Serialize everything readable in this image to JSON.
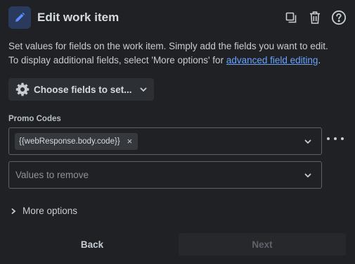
{
  "header": {
    "title": "Edit work item",
    "icons": [
      "pencil-icon",
      "copy-icon",
      "trash-icon",
      "help-icon"
    ]
  },
  "description": {
    "line1": "Set values for fields on the work item. Simply add the fields you want to edit.",
    "line2_prefix": "To display additional fields, select 'More options' for ",
    "link": "advanced field editing",
    "line2_suffix": "."
  },
  "choose_fields": {
    "label": "Choose fields to set..."
  },
  "promo_codes": {
    "label": "Promo Codes",
    "chip": "{{webResponse.body.code}}",
    "chip_remove": "×"
  },
  "values_to_remove": {
    "placeholder": "Values to remove"
  },
  "more_options": {
    "label": "More options"
  },
  "footer": {
    "back": "Back",
    "next": "Next"
  },
  "colors": {
    "background": "#1f2124",
    "link": "#6aa2ff",
    "icon_tile": "#2a3a5c",
    "button_bg": "#2c2f34"
  }
}
